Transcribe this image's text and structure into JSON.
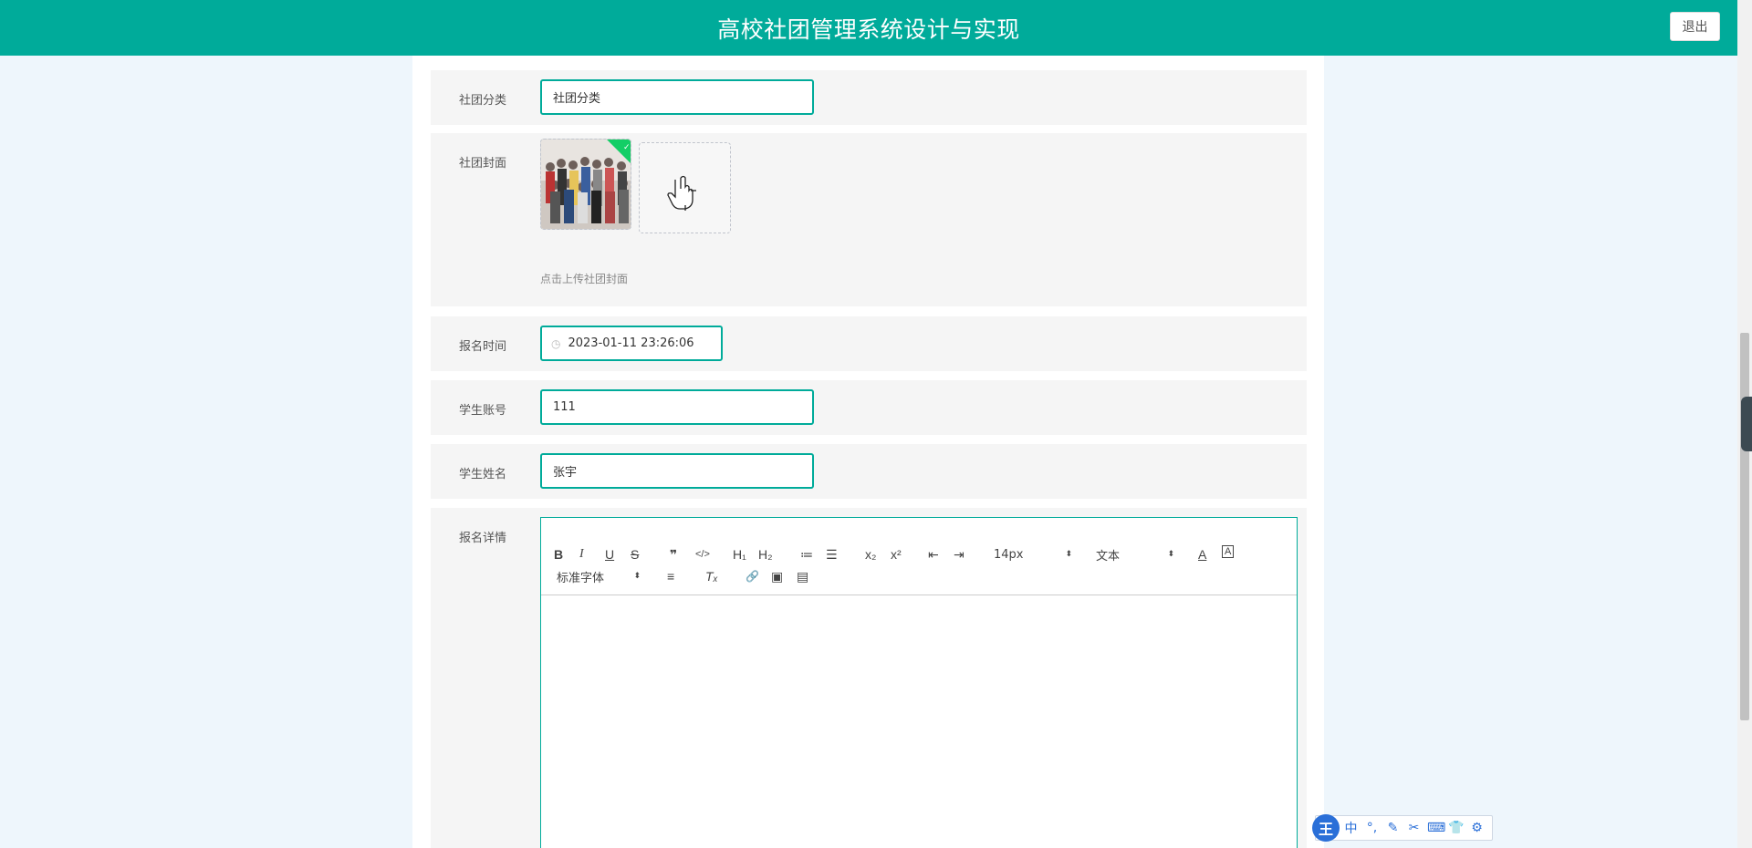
{
  "header": {
    "title": "高校社团管理系统设计与实现",
    "logout_label": "退出"
  },
  "form": {
    "category": {
      "label": "社团分类",
      "value": "社团分类"
    },
    "cover": {
      "label": "社团封面",
      "hint": "点击上传社团封面"
    },
    "signup_time": {
      "label": "报名时间",
      "value": "2023-01-11 23:26:06"
    },
    "student_account": {
      "label": "学生账号",
      "value": "111"
    },
    "student_name": {
      "label": "学生姓名",
      "value": "张宇"
    },
    "details": {
      "label": "报名详情"
    }
  },
  "editor": {
    "font_size": "14px",
    "header_picker": "文本",
    "font_picker": "标准字体",
    "buttons": {
      "bold": "B",
      "italic": "I",
      "underline": "U",
      "strike": "S",
      "quote": "❞",
      "code": "</>",
      "h1": "H₁",
      "h2": "H₂",
      "ordered": "≔",
      "bullet": "☰",
      "sub": "x₂",
      "sup": "x²",
      "outdent": "⇤",
      "indent": "⇥",
      "color": "A",
      "bg": "A",
      "align": "≡",
      "clean": "Tₓ",
      "link": "🔗",
      "image": "▣",
      "video": "▤"
    }
  },
  "ime": {
    "logo": "王",
    "items": [
      "中",
      "°,",
      "✎",
      "✂",
      "⌨",
      "👕",
      "⚙"
    ]
  },
  "colors": {
    "accent": "#00ab9a",
    "background": "#eef6fc"
  }
}
